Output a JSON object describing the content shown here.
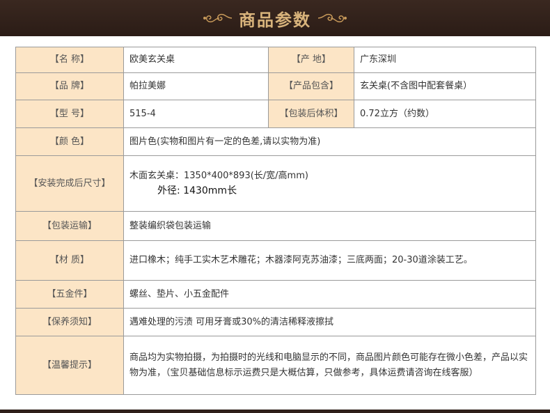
{
  "header": {
    "title": "商品参数"
  },
  "rows": [
    {
      "l1": "【名 称】",
      "v1": "欧美玄关桌",
      "l2": "【产 地】",
      "v2": "广东深圳"
    },
    {
      "l1": "【品 牌】",
      "v1": "帕拉美娜",
      "l2": "【产品包含】",
      "v2": "玄关桌(不含图中配套餐桌）"
    },
    {
      "l1": "【型 号】",
      "v1": "515-4",
      "l2": "【包装后体积】",
      "v2": "0.72立方（约数）"
    }
  ],
  "color": {
    "label": "【颜 色】",
    "value": "图片色(实物和图片有一定的色差,请以实物为准)"
  },
  "size": {
    "label": "【安装完成后尺寸】",
    "value": "木面玄关桌：1350*400*893(长/宽/高mm)",
    "outer": "外径: 1430mm长"
  },
  "packing": {
    "label": "【包装运输】",
    "value": "整装编织袋包装运输"
  },
  "material": {
    "label": "【材 质】",
    "value": "进口橡木；纯手工实木艺术雕花；木器漆阿克苏油漆；三底两面；20-30道涂装工艺。"
  },
  "hardware": {
    "label": "【五金件】",
    "value": "螺丝、垫片、小五金配件"
  },
  "care": {
    "label": "【保养须知】",
    "value": "遇难处理的污渍 可用牙膏或30%的清洁稀释液擦拭"
  },
  "notice": {
    "label": "【温馨提示】",
    "value": "商品均为实物拍摄，为拍摄时的光线和电脑显示的不同，商品图片颜色可能存在微小色差，产品以实物为准，（宝贝基础信息标示运费只是大概估算，只做参考，具体运费请咨询在线客服）"
  }
}
